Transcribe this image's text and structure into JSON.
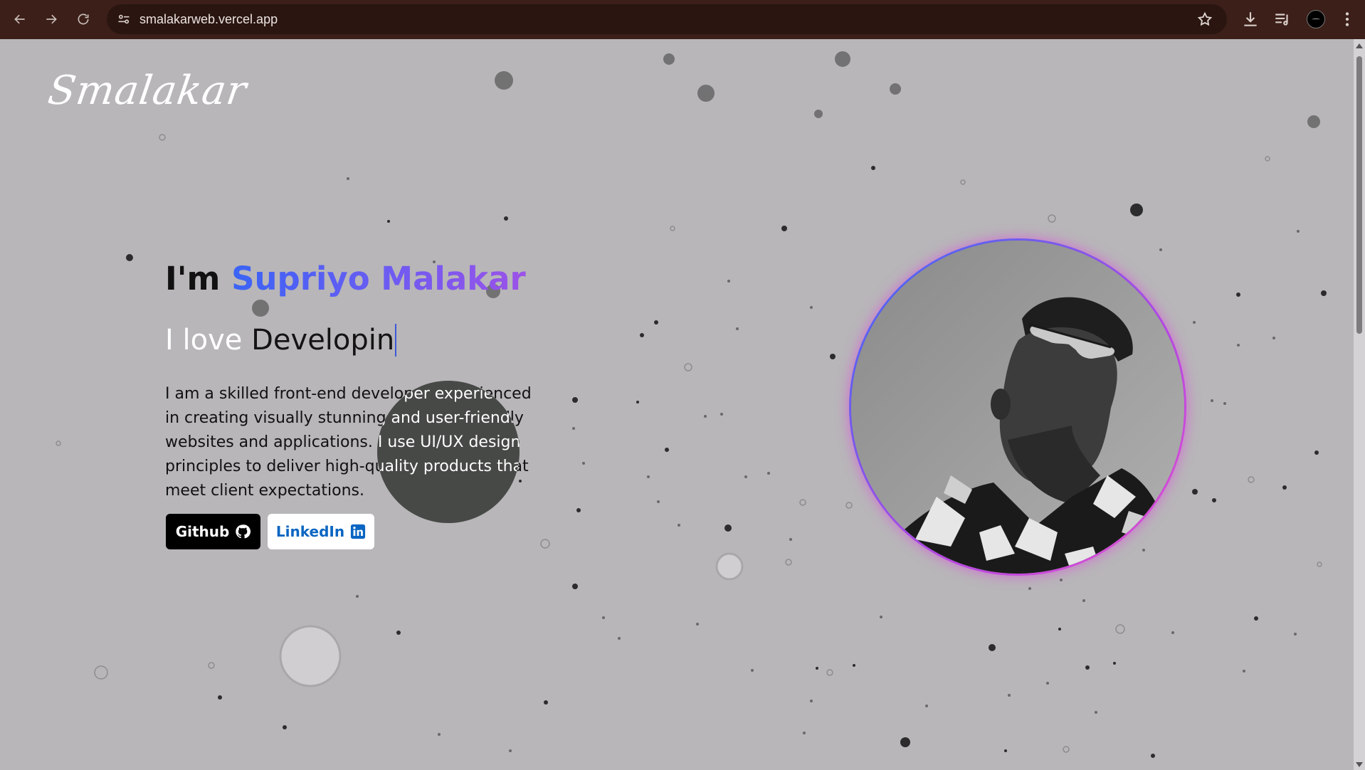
{
  "browser": {
    "url": "smalakarweb.vercel.app",
    "icons": [
      "back-arrow-icon",
      "forward-arrow-icon",
      "reload-icon",
      "site-settings-icon",
      "bookmark-star-icon",
      "download-icon",
      "media-playlist-icon",
      "profile-avatar",
      "menu-dots-icon"
    ]
  },
  "site": {
    "logo": "Smalakar"
  },
  "hero": {
    "greeting": "I'm",
    "name": "Supriyo Malakar",
    "love_prefix": "I love",
    "typed_text": "Developin",
    "bio": "I am a skilled front-end developer experienced in creating visually stunning and user-friendly websites and applications. I use UI/UX design principles to deliver high-quality products that meet client expectations.",
    "github_label": "Github",
    "linkedin_label": "LinkedIn"
  },
  "colors": {
    "name_gradient_start": "#3a64f5",
    "name_gradient_end": "#9b52e8",
    "avatar_ring": "#b446e4",
    "linkedin_blue": "#0a66c2",
    "page_bg": "#b8b6b9"
  }
}
